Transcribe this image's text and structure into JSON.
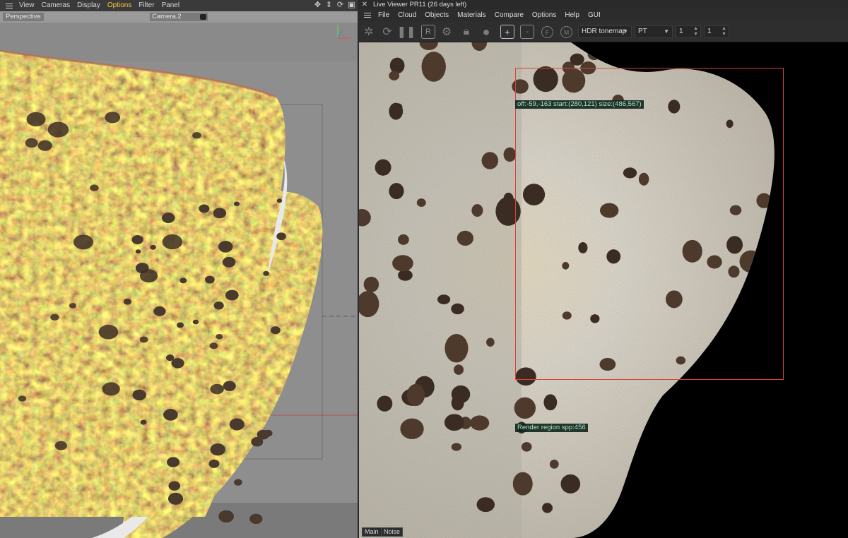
{
  "left_viewport": {
    "menu": [
      "View",
      "Cameras",
      "Display",
      "Options",
      "Filter",
      "Panel"
    ],
    "active_menu": "Options",
    "view_label": "Perspective",
    "camera": "Camera.2",
    "axis_labels": {
      "y": "y",
      "x": "x",
      "z": "z"
    }
  },
  "live_viewer": {
    "title": "Live Viewer PR11 (26 days left)",
    "menu": [
      "File",
      "Cloud",
      "Objects",
      "Materials",
      "Compare",
      "Options",
      "Help",
      "GUI"
    ],
    "toolbar": {
      "letter_r": "R",
      "letter_f": "F",
      "letter_m": "M",
      "tonemap": "HDR tonemap",
      "kernel": "PT",
      "spinner1": "1",
      "spinner2": "1"
    },
    "overlay": {
      "region_info": "off:-59,-163 start:(280,121) size:(486,567)",
      "region_spp": "Render region spp:456"
    },
    "bottom_tabs": [
      "Main",
      "Noise"
    ]
  },
  "colors": {
    "active_menu": "#f4c542",
    "region_box": "#d7443a",
    "overlay_text": "#a8e6c8"
  }
}
